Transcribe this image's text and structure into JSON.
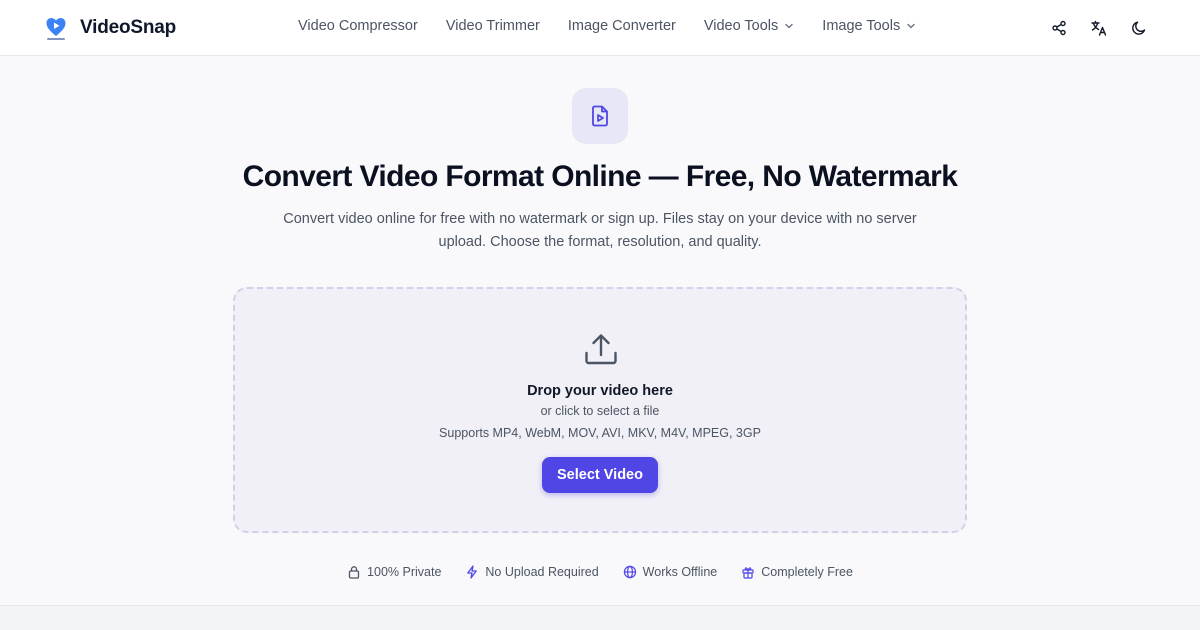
{
  "header": {
    "brand_name": "VideoSnap",
    "nav": [
      {
        "label": "Video Compressor",
        "dropdown": false
      },
      {
        "label": "Video Trimmer",
        "dropdown": false
      },
      {
        "label": "Image Converter",
        "dropdown": false
      },
      {
        "label": "Video Tools",
        "dropdown": true
      },
      {
        "label": "Image Tools",
        "dropdown": true
      }
    ],
    "icons": [
      "share-icon",
      "translate-icon",
      "moon-icon"
    ]
  },
  "hero": {
    "icon": "video-file-icon",
    "title": "Convert Video Format Online — Free, No Watermark",
    "subtitle_line1": "Convert video online for free with no watermark or sign up. Files stay on your device with no server",
    "subtitle_line2": "upload. Choose the format, resolution, and quality."
  },
  "dropzone": {
    "icon": "upload-icon",
    "title": "Drop your video here",
    "subtitle": "or click to select a file",
    "formats": "Supports MP4, WebM, MOV, AVI, MKV, M4V, MPEG, 3GP",
    "button_label": "Select Video"
  },
  "features": [
    {
      "icon": "lock-icon",
      "label": "100% Private"
    },
    {
      "icon": "bolt-icon",
      "label": "No Upload Required"
    },
    {
      "icon": "globe-icon",
      "label": "Works Offline"
    },
    {
      "icon": "gift-icon",
      "label": "Completely Free"
    }
  ],
  "colors": {
    "accent": "#4f46e5",
    "accent_light": "#e8e7f8",
    "logo_blue": "#3b82f6",
    "dropzone_bg": "#f1f0f7",
    "page_bg": "#f9f9fb"
  }
}
